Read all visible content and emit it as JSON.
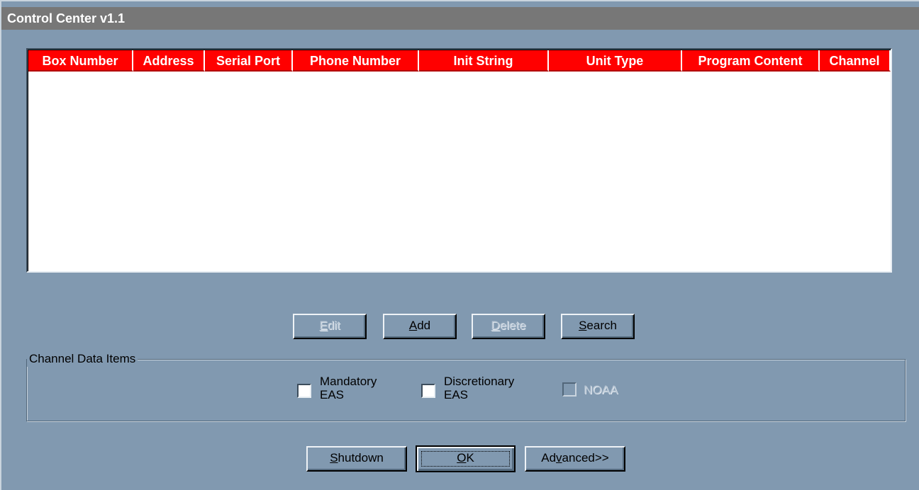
{
  "window": {
    "title": "Control Center v1.1"
  },
  "table": {
    "columns": [
      "Box Number",
      "Address",
      "Serial Port",
      "Phone Number",
      "Init String",
      "Unit Type",
      "Program Content",
      "Channel"
    ],
    "rows": []
  },
  "actions": {
    "edit": {
      "label": "Edit",
      "accel": "E",
      "rest": "dit",
      "enabled": false
    },
    "add": {
      "label": "Add",
      "accel": "A",
      "rest": "dd",
      "enabled": true
    },
    "delete": {
      "label": "Delete",
      "accel": "D",
      "rest": "elete",
      "enabled": false
    },
    "search": {
      "label": "Search",
      "accel": "S",
      "rest": "earch",
      "enabled": true
    }
  },
  "channel_group": {
    "title": "Channel Data Items",
    "items": [
      {
        "line1": "Mandatory",
        "line2": "EAS",
        "checked": false,
        "enabled": true
      },
      {
        "line1": "Discretionary",
        "line2": "EAS",
        "checked": false,
        "enabled": true
      },
      {
        "line1": "NOAA",
        "line2": "",
        "checked": false,
        "enabled": false
      }
    ]
  },
  "footer": {
    "shutdown": {
      "label": "Shutdown",
      "accel": "S",
      "rest": "hutdown"
    },
    "ok": {
      "label": "OK",
      "accel": "O",
      "rest": "K"
    },
    "advanced": {
      "label": "Advanced>>",
      "pre": "Ad",
      "accel": "v",
      "rest": "anced>>"
    }
  },
  "colors": {
    "face": "#8199b0",
    "header_bg": "#ff0000",
    "header_text": "#ffffff",
    "title_bg": "#777777",
    "list_bg": "#ffffff"
  }
}
